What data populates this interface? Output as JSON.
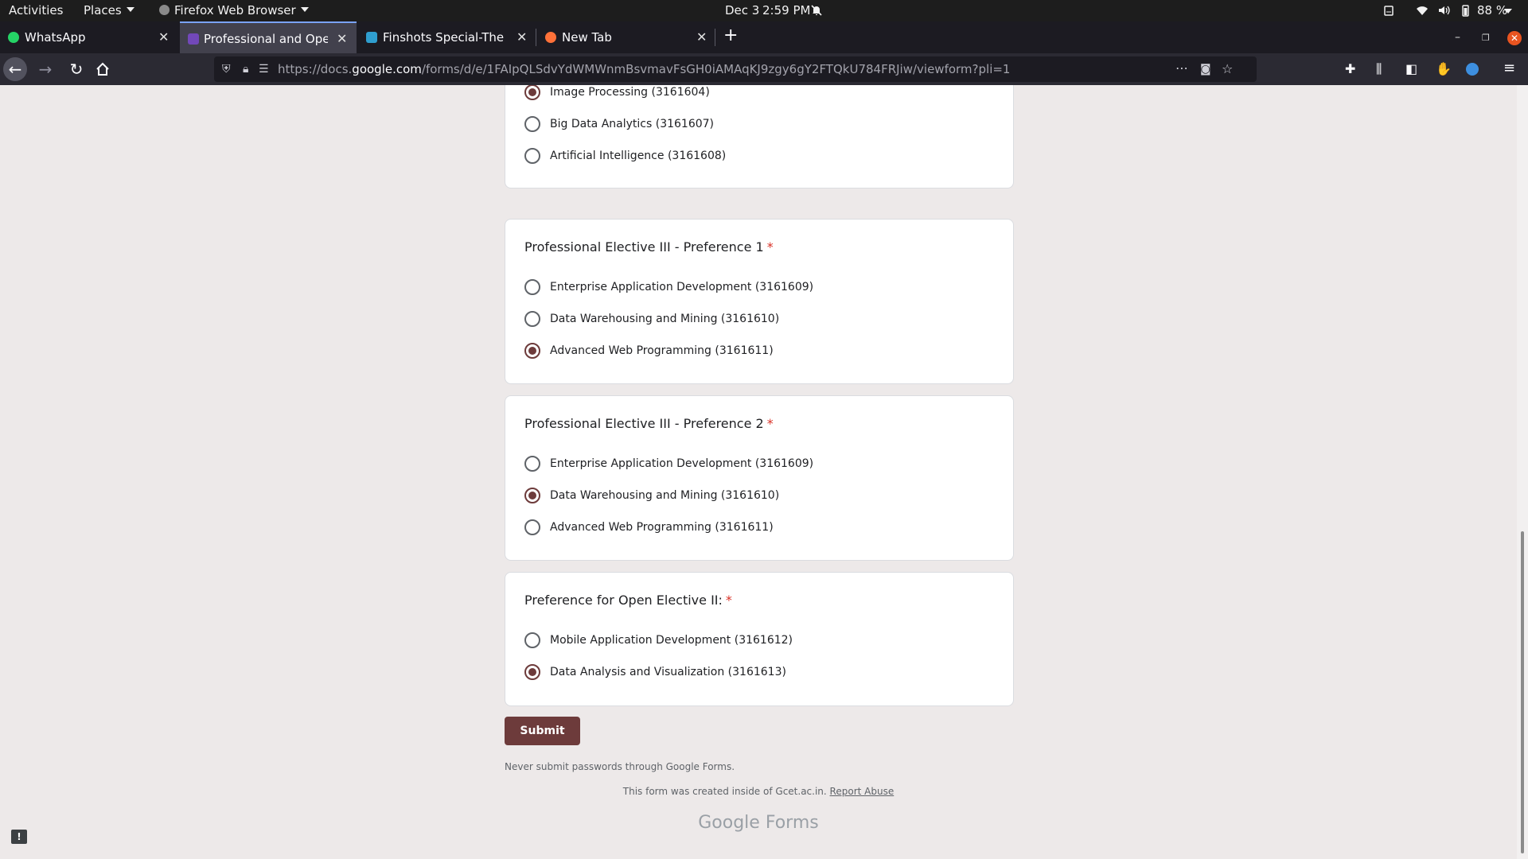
{
  "system_bar": {
    "activities": "Activities",
    "places": "Places",
    "app_name": "Firefox Web Browser",
    "date": "Dec 3",
    "time": "2:59 PM",
    "battery": "88 %"
  },
  "tabs": [
    {
      "label": "WhatsApp",
      "favicon_color": "#25d366"
    },
    {
      "label": "Professional and Open E",
      "favicon_color": "#7248b9"
    },
    {
      "label": "Finshots Special-The Bu",
      "favicon_color": "#2f9ecf"
    },
    {
      "label": "New Tab",
      "favicon_color": "#ff7139"
    }
  ],
  "navbar": {
    "url_prefix": "https://docs.",
    "url_host": "google.com",
    "url_path": "/forms/d/e/1FAIpQLSdvYdWMWnmBsvmavFsGH0iAMAqKJ9zgy6gY2FTQkU784FRJiw/viewform?pli=1"
  },
  "form": {
    "partial_question": {
      "options": [
        {
          "label": "Image Processing (3161604)",
          "checked": true
        },
        {
          "label": "Big Data Analytics (3161607)",
          "checked": false
        },
        {
          "label": "Artificial Intelligence (3161608)",
          "checked": false
        }
      ]
    },
    "questions": [
      {
        "title": "Professional Elective III - Preference 1",
        "required_mark": "*",
        "options": [
          {
            "label": "Enterprise Application Development (3161609)",
            "checked": false
          },
          {
            "label": "Data Warehousing and Mining (3161610)",
            "checked": false
          },
          {
            "label": "Advanced Web Programming (3161611)",
            "checked": true
          }
        ]
      },
      {
        "title": "Professional Elective III - Preference 2",
        "required_mark": "*",
        "options": [
          {
            "label": "Enterprise Application Development (3161609)",
            "checked": false
          },
          {
            "label": "Data Warehousing and Mining (3161610)",
            "checked": true
          },
          {
            "label": "Advanced Web Programming (3161611)",
            "checked": false
          }
        ]
      },
      {
        "title": "Preference for Open Elective II:",
        "required_mark": "*",
        "options": [
          {
            "label": "Mobile Application Development (3161612)",
            "checked": false
          },
          {
            "label": "Data Analysis and Visualization (3161613)",
            "checked": true
          }
        ]
      }
    ],
    "submit_label": "Submit",
    "password_notice": "Never submit passwords through Google Forms.",
    "created_text": "This form was created inside of Gcet.ac.in.",
    "report_abuse": "Report Abuse",
    "brand_google": "Google",
    "brand_forms": "Forms",
    "accent_color": "#6d3b3b"
  }
}
